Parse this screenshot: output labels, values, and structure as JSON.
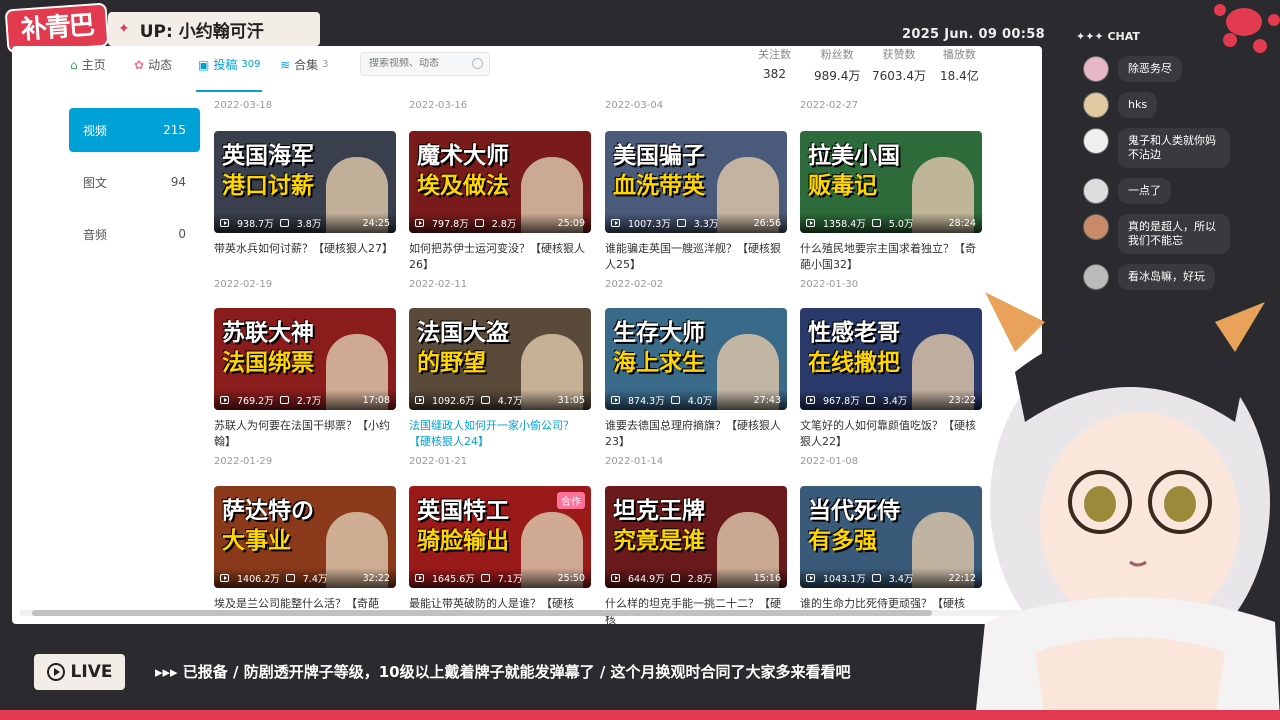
{
  "overlay": {
    "logo": "补青巴",
    "up_label": "UP: 小约翰可汗",
    "datetime": "2025 Jun. 09 00:58",
    "chat_title": "✦✦✦ CHAT",
    "chat": [
      {
        "text": "除恶务尽",
        "color": "#e9b8c8"
      },
      {
        "text": "hks",
        "color": "#e0c9a0"
      },
      {
        "text": "鬼子和人类就你妈不沾边",
        "color": "#f0f0f0"
      },
      {
        "text": "一点了",
        "color": "#dddddd"
      },
      {
        "text": "真的是超人，所以我们不能忘",
        "color": "#c98a6a"
      },
      {
        "text": "看冰岛嘛，好玩",
        "color": "#bbbbbb"
      }
    ],
    "live_label": "LIVE",
    "ticker": "▸▸▸  已报备  /  防剧透开牌子等级，10级以上戴着牌子就能发弹幕了  /  这个月换观时合同了大家多来看看吧"
  },
  "nav": {
    "home": "主页",
    "dynamic": "动态",
    "uploads": "投稿",
    "uploads_count": "309",
    "collections": "合集",
    "collections_count": "3",
    "search_placeholder": "搜索视频、动态"
  },
  "stats": [
    {
      "label": "关注数",
      "value": "382"
    },
    {
      "label": "粉丝数",
      "value": "989.4万"
    },
    {
      "label": "获赞数",
      "value": "7603.4万"
    },
    {
      "label": "播放数",
      "value": "18.4亿"
    }
  ],
  "sidebar": [
    {
      "label": "视频",
      "count": "215",
      "active": true
    },
    {
      "label": "图文",
      "count": "94"
    },
    {
      "label": "音频",
      "count": "0"
    }
  ],
  "top_dates": [
    "2022-03-18",
    "2022-03-16",
    "2022-03-04",
    "2022-02-27"
  ],
  "videos": [
    {
      "t1": "英国海军",
      "t2": "港口讨薪",
      "views": "938.7万",
      "danmaku": "3.8万",
      "duration": "24:25",
      "title": "带英水兵如何讨薪？【硬核狠人27】",
      "date": "2022-02-19",
      "bg": "#3a3f4d"
    },
    {
      "t1": "魔术大师",
      "t2": "埃及做法",
      "views": "797.8万",
      "danmaku": "2.8万",
      "duration": "25:09",
      "title": "如何把苏伊士运河变没？【硬核狠人26】",
      "date": "2022-02-11",
      "bg": "#7a1b1b"
    },
    {
      "t1": "美国骗子",
      "t2": "血洗带英",
      "views": "1007.3万",
      "danmaku": "3.3万",
      "duration": "26:56",
      "title": "谁能骗走英国一艘巡洋舰？【硬核狠人25】",
      "date": "2022-02-02",
      "bg": "#4a5a7a"
    },
    {
      "t1": "拉美小国",
      "t2": "贩毒记",
      "views": "1358.4万",
      "danmaku": "5.0万",
      "duration": "28:24",
      "title": "什么殖民地要宗主国求着独立？【奇葩小国32】",
      "date": "2022-01-30",
      "bg": "#2e6b3a"
    },
    {
      "t1": "苏联大神",
      "t2": "法国绑票",
      "views": "769.2万",
      "danmaku": "2.7万",
      "duration": "17:08",
      "title": "苏联人为何要在法国干绑票？【小约翰】",
      "date": "2022-01-29",
      "bg": "#8a1c1c"
    },
    {
      "t1": "法国大盗",
      "t2": "的野望",
      "views": "1092.6万",
      "danmaku": "4.7万",
      "duration": "31:05",
      "title": "法国缝政人如何开一家小偷公司？【硬核狠人24】",
      "date": "2022-01-21",
      "bg": "#5a4a3a",
      "link": true
    },
    {
      "t1": "生存大师",
      "t2": "海上求生",
      "views": "874.3万",
      "danmaku": "4.0万",
      "duration": "27:43",
      "title": "谁要去德国总理府摘旗？【硬核狠人23】",
      "date": "2022-01-14",
      "bg": "#3a6a8a"
    },
    {
      "t1": "性感老哥",
      "t2": "在线撒把",
      "views": "967.8万",
      "danmaku": "3.4万",
      "duration": "23:22",
      "title": "文笔好的人如何靠颜值吃饭？【硬核狠人22】",
      "date": "2022-01-08",
      "bg": "#2a3a6a"
    },
    {
      "t1": "萨达特の",
      "t2": "大事业",
      "views": "1406.2万",
      "danmaku": "7.4万",
      "duration": "32:22",
      "title": "埃及是兰公司能整什么活？【奇葩",
      "date": "",
      "bg": "#8a3a1a"
    },
    {
      "t1": "英国特工",
      "t2": "骑脸输出",
      "views": "1645.6万",
      "danmaku": "7.1万",
      "duration": "25:50",
      "title": "最能让带英破防的人是谁？【硬核",
      "date": "",
      "bg": "#9a1a1a",
      "badge": "合作"
    },
    {
      "t1": "坦克王牌",
      "t2": "究竟是谁",
      "views": "644.9万",
      "danmaku": "2.8万",
      "duration": "15:16",
      "title": "什么样的坦克手能一挑二十二？【硬核",
      "date": "",
      "bg": "#6a1a1a"
    },
    {
      "t1": "当代死侍",
      "t2": "有多强",
      "views": "1043.1万",
      "danmaku": "3.4万",
      "duration": "22:12",
      "title": "谁的生命力比死侍更顽强？【硬核",
      "date": "",
      "bg": "#3a5a7a"
    }
  ]
}
